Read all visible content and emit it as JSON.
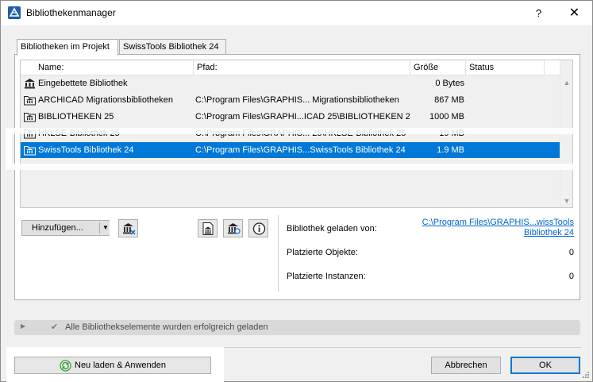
{
  "window": {
    "title": "Bibliothekenmanager",
    "help_label": "?",
    "close_label": "✕"
  },
  "tabs": [
    {
      "label": "Bibliotheken im Projekt",
      "active": true
    },
    {
      "label": "SwissTools Bibliothek 24",
      "active": false
    }
  ],
  "table": {
    "columns": [
      "Name:",
      "Pfad:",
      "Größe",
      "Status"
    ],
    "rows": [
      {
        "name": "Eingebettete Bibliothek",
        "path": "",
        "size": "0 Bytes",
        "status": "",
        "icon": "embedded-library-icon"
      },
      {
        "name": "ARCHICAD Migrationsbibliotheken",
        "path": "C:\\Program Files\\GRAPHIS... Migrationsbibliotheken",
        "size": "867 MB",
        "status": "",
        "icon": "folder-library-icon"
      },
      {
        "name": "BIBLIOTHEKEN 25",
        "path": "C:\\Program Files\\GRAPHI...ICAD 25\\BIBLIOTHEKEN 25",
        "size": "1000 MB",
        "status": "",
        "icon": "folder-library-icon"
      },
      {
        "name": "HKLSE-Bibliothek 25",
        "path": "C:\\Program Files\\GRAPHIS... 25\\HKLSE-Bibliothek 25",
        "size": "19 MB",
        "status": "",
        "icon": "folder-library-icon"
      },
      {
        "name": "SwissTools Bibliothek 24",
        "path": "C:\\Program Files\\GRAPHIS...SwissTools Bibliothek 24",
        "size": "1.9 MB",
        "status": "",
        "icon": "folder-library-icon",
        "selected": true
      }
    ]
  },
  "controls": {
    "add_label": "Hinzufügen...",
    "add_dropdown_glyph": "▼"
  },
  "info": {
    "loaded_from_label": "Bibliothek geladen von:",
    "loaded_from_line1": "C:\\Program Files\\GRAPHIS...wissTools",
    "loaded_from_line2": "Bibliothek 24",
    "placed_objects_label": "Platzierte Objekte:",
    "placed_objects_value": "0",
    "placed_instances_label": "Platzierte Instanzen:",
    "placed_instances_value": "0"
  },
  "status": {
    "message": "Alle Bibliothekselemente wurden erfolgreich geladen"
  },
  "footer": {
    "reload_label": "Neu laden & Anwenden",
    "cancel_label": "Abbrechen",
    "ok_label": "OK"
  },
  "colors": {
    "selection": "#0078d7",
    "link": "#0066cc",
    "reload_icon": "#3a9a3a"
  }
}
